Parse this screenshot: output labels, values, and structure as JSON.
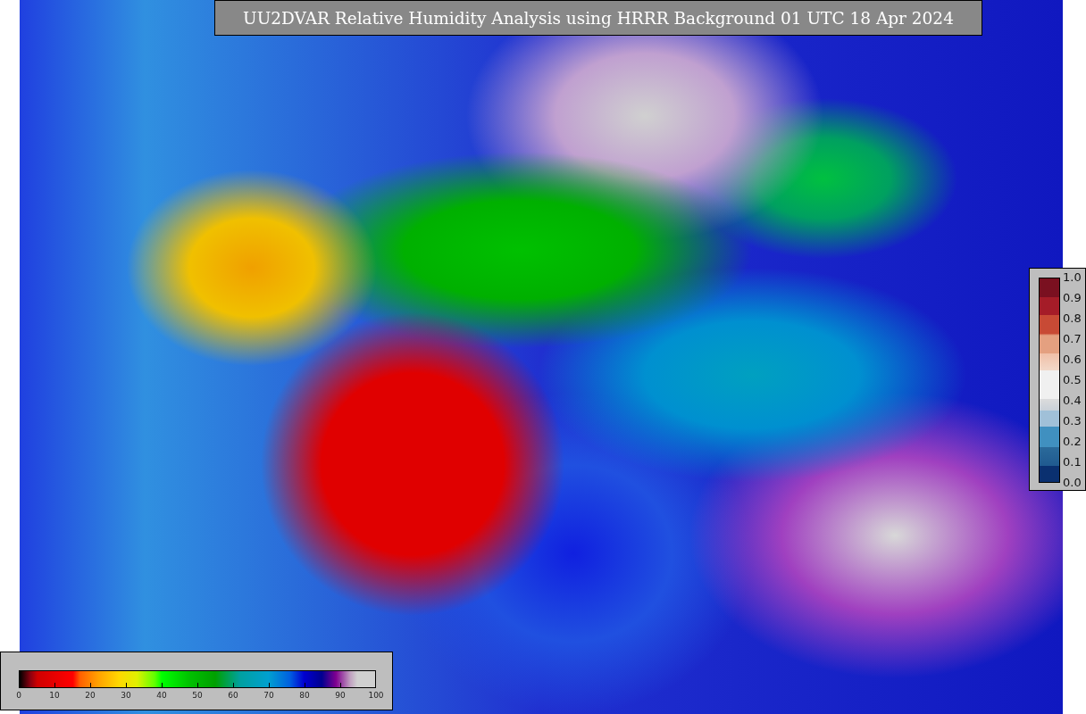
{
  "title": "UU2DVAR Relative Humidity Analysis using HRRR Background 01 UTC 18 Apr 2024",
  "humidity_colorbar": {
    "tick_labels": [
      "0",
      "10",
      "20",
      "30",
      "40",
      "50",
      "60",
      "70",
      "80",
      "90",
      "100"
    ]
  },
  "difference_colorbar": {
    "tick_labels": [
      "1.0",
      "0.9",
      "0.8",
      "0.7",
      "0.6",
      "0.5",
      "0.4",
      "0.3",
      "0.2",
      "0.1",
      "0.0"
    ]
  }
}
